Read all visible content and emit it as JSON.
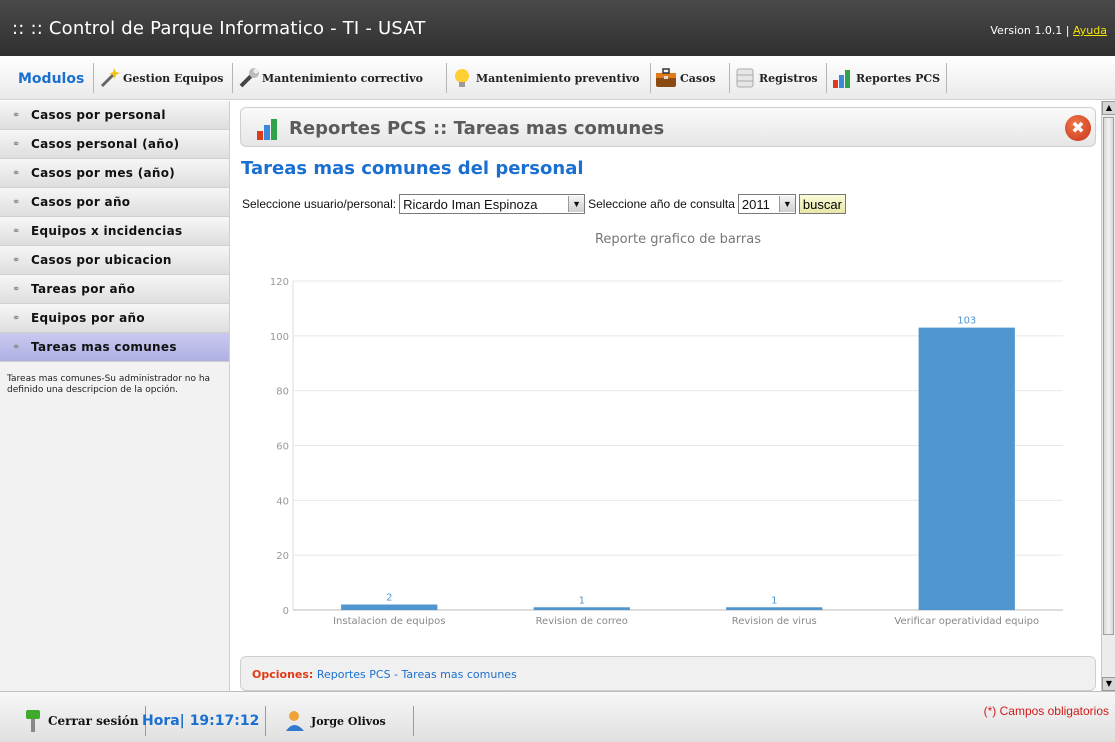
{
  "app": {
    "title": ":: :: Control de Parque Informatico - TI - USAT",
    "version": "Version 1.0.1 |",
    "help_link": "Ayuda"
  },
  "menu": {
    "modulos_label": "Modulos",
    "items": [
      {
        "label": "Gestion Equipos",
        "icon": "magic-wand-icon"
      },
      {
        "label": "Mantenimiento correctivo",
        "icon": "wrench-icon"
      },
      {
        "label": "Mantenimiento preventivo",
        "icon": "lightbulb-icon"
      },
      {
        "label": "Casos",
        "icon": "briefcase-icon"
      },
      {
        "label": "Registros",
        "icon": "database-icon"
      },
      {
        "label": "Reportes PCS",
        "icon": "bar-chart-icon"
      }
    ]
  },
  "sidebar": {
    "items": [
      {
        "label": "Casos por personal"
      },
      {
        "label": "Casos personal (año)"
      },
      {
        "label": "Casos por mes (año)"
      },
      {
        "label": "Casos por año"
      },
      {
        "label": "Equipos x incidencias"
      },
      {
        "label": "Casos por ubicacion"
      },
      {
        "label": "Tareas por año"
      },
      {
        "label": "Equipos por año"
      },
      {
        "label": "Tareas mas comunes",
        "active": true
      }
    ],
    "description": "Tareas mas comunes-Su administrador no ha definido una descripcion de la opción."
  },
  "panel": {
    "title": "Reportes PCS  :: Tareas mas comunes",
    "subtitle": "Tareas mas comunes del personal"
  },
  "filters": {
    "user_label": "Seleccione usuario/personal:",
    "user_value": "Ricardo Iman Espinoza",
    "year_label": "Seleccione año de consulta",
    "year_value": "2011",
    "search_button": "buscar"
  },
  "chart_data": {
    "type": "bar",
    "title": "Reporte grafico de barras",
    "categories": [
      "Instalacion de equipos",
      "Revision de correo",
      "Revision de virus",
      "Verificar operatividad equipo"
    ],
    "values": [
      2,
      1,
      1,
      103
    ],
    "yticks": [
      0,
      20,
      40,
      60,
      80,
      100,
      120
    ],
    "ylim": [
      0,
      120
    ],
    "grid": true,
    "bar_color": "#4f96d0"
  },
  "options": {
    "label": "Opciones:",
    "path": "Reportes PCS - Tareas mas comunes"
  },
  "footer": {
    "logout": "Cerrar sesión",
    "clock_label": "Hora|",
    "clock_value": "19:17:12",
    "user_name": "Jorge Olivos",
    "required_note": "(*) Campos obligatorios"
  }
}
